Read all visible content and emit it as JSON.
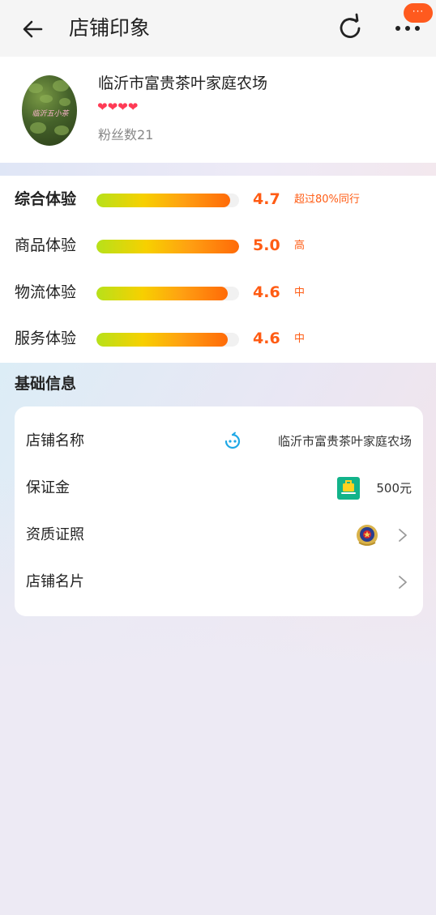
{
  "header": {
    "title": "店铺印象",
    "notification_badge": "···"
  },
  "shop": {
    "name": "临沂市富贵茶叶家庭农场",
    "avatar_text": "临沂五小茶",
    "hearts": "❤❤❤❤",
    "heart_count": 4,
    "fans_label": "粉丝数21"
  },
  "scores": [
    {
      "label": "综合体验",
      "value": "4.7",
      "tag": "超过80%同行",
      "fill": 0.94
    },
    {
      "label": "商品体验",
      "value": "5.0",
      "tag": "高",
      "fill": 1.0
    },
    {
      "label": "物流体验",
      "value": "4.6",
      "tag": "中",
      "fill": 0.92
    },
    {
      "label": "服务体验",
      "value": "4.6",
      "tag": "中",
      "fill": 0.92
    }
  ],
  "basic_info": {
    "title": "基础信息",
    "rows": [
      {
        "label": "店铺名称",
        "value": "临沂市富贵茶叶家庭农场",
        "icon": "chat-bot-icon"
      },
      {
        "label": "保证金",
        "value": "500元",
        "icon": "deposit-shield-icon"
      },
      {
        "label": "资质证照",
        "value": "",
        "icon": "police-emblem-icon"
      },
      {
        "label": "店铺名片",
        "value": "",
        "icon": ""
      }
    ]
  },
  "colors": {
    "accent": "#ff5c14",
    "heart": "#ff3b55",
    "badge": "#ff5a1e",
    "bar_start": "#b7e11a",
    "bar_end": "#ff6a08"
  }
}
